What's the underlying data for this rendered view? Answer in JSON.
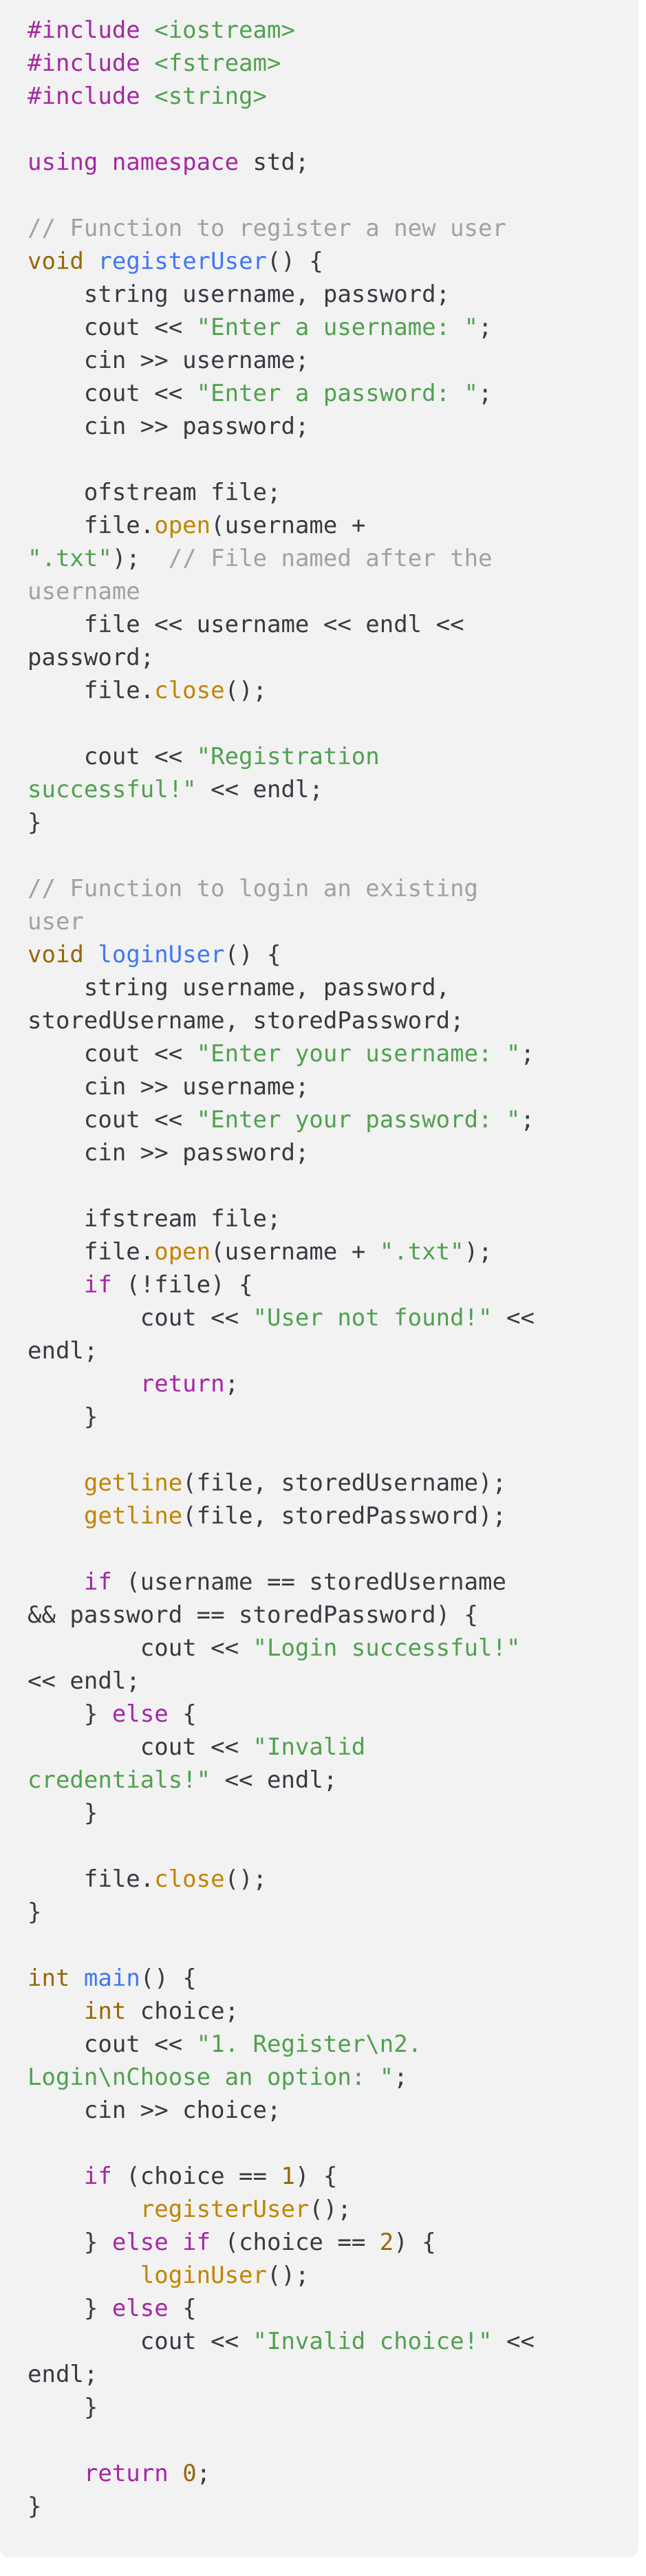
{
  "colors": {
    "background": "#f2f2f2",
    "text": "#383a42",
    "keyword": "#a626a4",
    "type": "#986801",
    "function": "#4078f2",
    "call": "#c18401",
    "string": "#50a14f",
    "number": "#986801",
    "comment": "#a0a1a7"
  },
  "code": {
    "lines": [
      [
        [
          "pp",
          "#include "
        ],
        [
          "str",
          "<iostream>"
        ]
      ],
      [
        [
          "pp",
          "#include "
        ],
        [
          "str",
          "<fstream>"
        ]
      ],
      [
        [
          "pp",
          "#include "
        ],
        [
          "str",
          "<string>"
        ]
      ],
      [],
      [
        [
          "kw",
          "using namespace"
        ],
        [
          "plain",
          " std;"
        ]
      ],
      [],
      [
        [
          "com",
          "// Function to register a new user"
        ]
      ],
      [
        [
          "type",
          "void"
        ],
        [
          "plain",
          " "
        ],
        [
          "fn",
          "registerUser"
        ],
        [
          "plain",
          "() {"
        ]
      ],
      [
        [
          "plain",
          "    string username, password;"
        ]
      ],
      [
        [
          "plain",
          "    cout << "
        ],
        [
          "str",
          "\"Enter a username: \""
        ],
        [
          "plain",
          ";"
        ]
      ],
      [
        [
          "plain",
          "    cin >> username;"
        ]
      ],
      [
        [
          "plain",
          "    cout << "
        ],
        [
          "str",
          "\"Enter a password: \""
        ],
        [
          "plain",
          ";"
        ]
      ],
      [
        [
          "plain",
          "    cin >> password;"
        ]
      ],
      [],
      [
        [
          "plain",
          "    ofstream file;"
        ]
      ],
      [
        [
          "plain",
          "    file."
        ],
        [
          "call",
          "open"
        ],
        [
          "plain",
          "(username +"
        ]
      ],
      [
        [
          "str",
          "\".txt\""
        ],
        [
          "plain",
          ");  "
        ],
        [
          "com",
          "// File named after the"
        ]
      ],
      [
        [
          "com",
          "username"
        ]
      ],
      [
        [
          "plain",
          "    file << username << endl <<"
        ]
      ],
      [
        [
          "plain",
          "password;"
        ]
      ],
      [
        [
          "plain",
          "    file."
        ],
        [
          "call",
          "close"
        ],
        [
          "plain",
          "();"
        ]
      ],
      [],
      [
        [
          "plain",
          "    cout << "
        ],
        [
          "str",
          "\"Registration"
        ]
      ],
      [
        [
          "str",
          "successful!\""
        ],
        [
          "plain",
          " << endl;"
        ]
      ],
      [
        [
          "plain",
          "}"
        ]
      ],
      [],
      [
        [
          "com",
          "// Function to login an existing"
        ]
      ],
      [
        [
          "com",
          "user"
        ]
      ],
      [
        [
          "type",
          "void"
        ],
        [
          "plain",
          " "
        ],
        [
          "fn",
          "loginUser"
        ],
        [
          "plain",
          "() {"
        ]
      ],
      [
        [
          "plain",
          "    string username, password,"
        ]
      ],
      [
        [
          "plain",
          "storedUsername, storedPassword;"
        ]
      ],
      [
        [
          "plain",
          "    cout << "
        ],
        [
          "str",
          "\"Enter your username: \""
        ],
        [
          "plain",
          ";"
        ]
      ],
      [
        [
          "plain",
          "    cin >> username;"
        ]
      ],
      [
        [
          "plain",
          "    cout << "
        ],
        [
          "str",
          "\"Enter your password: \""
        ],
        [
          "plain",
          ";"
        ]
      ],
      [
        [
          "plain",
          "    cin >> password;"
        ]
      ],
      [],
      [
        [
          "plain",
          "    ifstream file;"
        ]
      ],
      [
        [
          "plain",
          "    file."
        ],
        [
          "call",
          "open"
        ],
        [
          "plain",
          "(username + "
        ],
        [
          "str",
          "\".txt\""
        ],
        [
          "plain",
          ");"
        ]
      ],
      [
        [
          "kw",
          "    if"
        ],
        [
          "plain",
          " (!file) {"
        ]
      ],
      [
        [
          "plain",
          "        cout << "
        ],
        [
          "str",
          "\"User not found!\""
        ],
        [
          "plain",
          " <<"
        ]
      ],
      [
        [
          "plain",
          "endl;"
        ]
      ],
      [
        [
          "kw",
          "        return"
        ],
        [
          "plain",
          ";"
        ]
      ],
      [
        [
          "plain",
          "    }"
        ]
      ],
      [],
      [
        [
          "call",
          "    getline"
        ],
        [
          "plain",
          "(file, storedUsername);"
        ]
      ],
      [
        [
          "call",
          "    getline"
        ],
        [
          "plain",
          "(file, storedPassword);"
        ]
      ],
      [],
      [
        [
          "kw",
          "    if"
        ],
        [
          "plain",
          " (username == storedUsername"
        ]
      ],
      [
        [
          "plain",
          "&& password == storedPassword) {"
        ]
      ],
      [
        [
          "plain",
          "        cout << "
        ],
        [
          "str",
          "\"Login successful!\""
        ]
      ],
      [
        [
          "plain",
          "<< endl;"
        ]
      ],
      [
        [
          "plain",
          "    } "
        ],
        [
          "kw",
          "else"
        ],
        [
          "plain",
          " {"
        ]
      ],
      [
        [
          "plain",
          "        cout << "
        ],
        [
          "str",
          "\"Invalid"
        ]
      ],
      [
        [
          "str",
          "credentials!\""
        ],
        [
          "plain",
          " << endl;"
        ]
      ],
      [
        [
          "plain",
          "    }"
        ]
      ],
      [],
      [
        [
          "plain",
          "    file."
        ],
        [
          "call",
          "close"
        ],
        [
          "plain",
          "();"
        ]
      ],
      [
        [
          "plain",
          "}"
        ]
      ],
      [],
      [
        [
          "type",
          "int"
        ],
        [
          "plain",
          " "
        ],
        [
          "fn",
          "main"
        ],
        [
          "plain",
          "() {"
        ]
      ],
      [
        [
          "type",
          "    int"
        ],
        [
          "plain",
          " choice;"
        ]
      ],
      [
        [
          "plain",
          "    cout << "
        ],
        [
          "str",
          "\"1. Register\\n2."
        ]
      ],
      [
        [
          "str",
          "Login\\nChoose an option: \""
        ],
        [
          "plain",
          ";"
        ]
      ],
      [
        [
          "plain",
          "    cin >> choice;"
        ]
      ],
      [],
      [
        [
          "kw",
          "    if"
        ],
        [
          "plain",
          " (choice == "
        ],
        [
          "num",
          "1"
        ],
        [
          "plain",
          ") {"
        ]
      ],
      [
        [
          "call",
          "        registerUser"
        ],
        [
          "plain",
          "();"
        ]
      ],
      [
        [
          "plain",
          "    } "
        ],
        [
          "kw",
          "else if"
        ],
        [
          "plain",
          " (choice == "
        ],
        [
          "num",
          "2"
        ],
        [
          "plain",
          ") {"
        ]
      ],
      [
        [
          "call",
          "        loginUser"
        ],
        [
          "plain",
          "();"
        ]
      ],
      [
        [
          "plain",
          "    } "
        ],
        [
          "kw",
          "else"
        ],
        [
          "plain",
          " {"
        ]
      ],
      [
        [
          "plain",
          "        cout << "
        ],
        [
          "str",
          "\"Invalid choice!\""
        ],
        [
          "plain",
          " <<"
        ]
      ],
      [
        [
          "plain",
          "endl;"
        ]
      ],
      [
        [
          "plain",
          "    }"
        ]
      ],
      [],
      [
        [
          "kw",
          "    return"
        ],
        [
          "plain",
          " "
        ],
        [
          "num",
          "0"
        ],
        [
          "plain",
          ";"
        ]
      ],
      [
        [
          "plain",
          "}"
        ]
      ]
    ]
  }
}
